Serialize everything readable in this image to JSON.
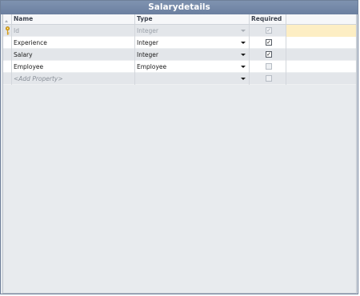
{
  "window": {
    "title": "Salarydetails"
  },
  "columns": {
    "name": "Name",
    "type": "Type",
    "required": "Required"
  },
  "rows": [
    {
      "name": "Id",
      "type": "Integer",
      "required": true,
      "is_key": true,
      "disabled": true
    },
    {
      "name": "Experience",
      "type": "Integer",
      "required": true,
      "is_key": false,
      "disabled": false
    },
    {
      "name": "Salary",
      "type": "Integer",
      "required": true,
      "is_key": false,
      "disabled": false
    },
    {
      "name": "Employee",
      "type": "Employee",
      "required": false,
      "is_key": false,
      "disabled": false
    }
  ],
  "new_row": {
    "placeholder": "<Add Property>",
    "type": ""
  },
  "icons": {
    "key": "key-icon",
    "dropdown": "chevron-down-icon",
    "checkbox": "checkbox"
  },
  "colors": {
    "title_bar": "#7487a6",
    "key_row_highlight": "#fdeec4",
    "alt_row": "#e3e6ea"
  }
}
